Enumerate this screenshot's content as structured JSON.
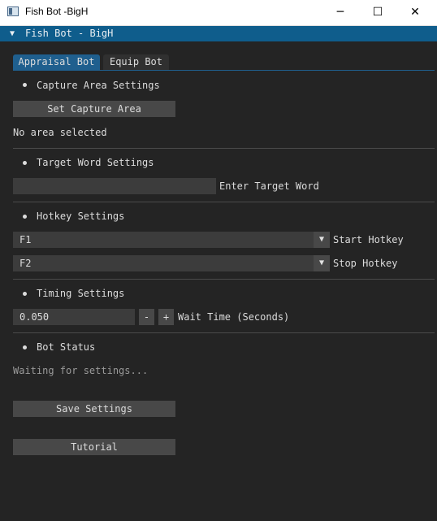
{
  "window": {
    "title": "Fish Bot -BigH",
    "minimize_glyph": "─",
    "maximize_glyph": "☐",
    "close_glyph": "✕"
  },
  "imgui": {
    "collapse_glyph": "▼",
    "title": "Fish Bot - BigH"
  },
  "tabs": [
    {
      "label": "Appraisal Bot",
      "active": true
    },
    {
      "label": "Equip Bot",
      "active": false
    }
  ],
  "capture": {
    "header": "Capture Area Settings",
    "button": "Set Capture Area",
    "status": "No area selected"
  },
  "target": {
    "header": "Target Word Settings",
    "value": "",
    "label": "Enter Target Word"
  },
  "hotkey": {
    "header": "Hotkey Settings",
    "start_value": "F1",
    "start_label": "Start Hotkey",
    "stop_value": "F2",
    "stop_label": "Stop Hotkey",
    "arrow_glyph": "▼"
  },
  "timing": {
    "header": "Timing Settings",
    "value": "0.050",
    "minus": "-",
    "plus": "+",
    "label": "Wait Time (Seconds)"
  },
  "status": {
    "header": "Bot Status",
    "text": "Waiting for settings..."
  },
  "actions": {
    "save": "Save Settings",
    "tutorial": "Tutorial"
  },
  "colors": {
    "accent": "#0f5d8c",
    "tab_active": "#1f5f8e",
    "background": "#242424",
    "button": "#484848",
    "field": "#3c3c3c"
  }
}
